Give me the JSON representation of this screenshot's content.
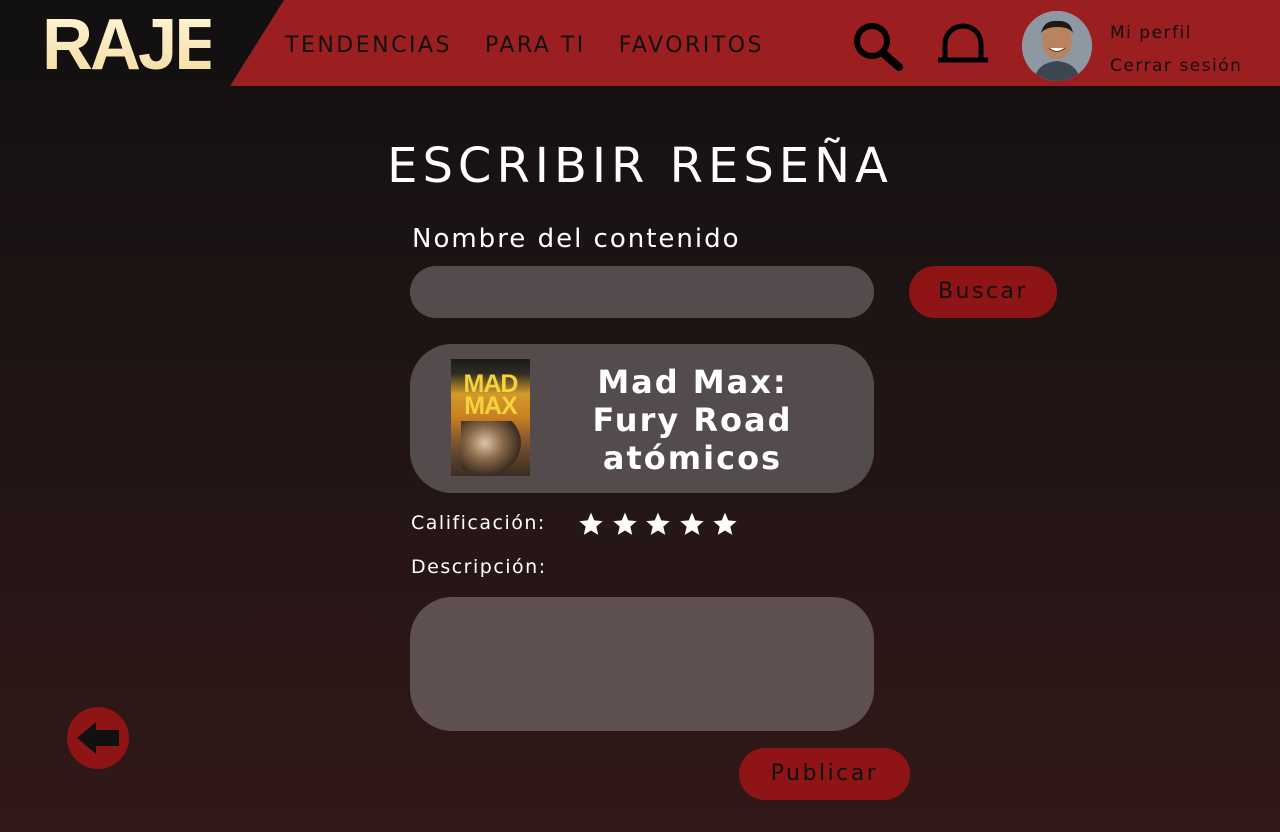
{
  "brand": {
    "logo_text": "RAJE"
  },
  "nav": {
    "items": [
      {
        "label": "TENDENCIAS"
      },
      {
        "label": "PARA TI"
      },
      {
        "label": "FAVORITOS"
      }
    ]
  },
  "header_icons": {
    "search": "search-icon",
    "notifications": "bell-icon"
  },
  "profile": {
    "my_profile": "Mi perfil",
    "logout": "Cerrar sesión"
  },
  "page": {
    "title": "ESCRIBIR RESEÑA"
  },
  "form": {
    "content_label": "Nombre del contenido",
    "content_value": "",
    "search_label": "Buscar",
    "result": {
      "poster_title": "MAD MAX",
      "title": "Mad Max: Fury Road atómicos"
    },
    "rating_label": "Calificación:",
    "rating": {
      "value": 5,
      "max": 5
    },
    "description_label": "Descripción:",
    "description_value": "",
    "publish_label": "Publicar"
  },
  "colors": {
    "header_bg": "#9b1f21",
    "accent_button": "#8f1416",
    "input_bg": "#544c4c",
    "logo": "#fbe9b8"
  }
}
